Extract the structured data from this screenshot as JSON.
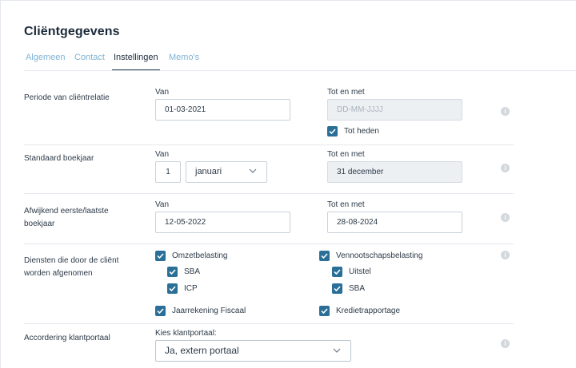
{
  "page": {
    "title": "Cliëntgegevens"
  },
  "tabs": [
    {
      "label": "Algemeen",
      "active": false
    },
    {
      "label": "Contact",
      "active": false
    },
    {
      "label": "Instellingen",
      "active": true
    },
    {
      "label": "Memo's",
      "active": false
    }
  ],
  "rows": {
    "periode": {
      "label": "Periode van cliëntrelatie",
      "van_label": "Van",
      "van_value": "01-03-2021",
      "tot_label": "Tot en met",
      "tot_placeholder": "DD-MM-JJJJ",
      "tot_heden_label": "Tot heden",
      "tot_heden_checked": true
    },
    "boekjaar": {
      "label": "Standaard boekjaar",
      "van_label": "Van",
      "dag_value": "1",
      "maand_value": "januari",
      "tot_label": "Tot en met",
      "tot_value": "31 december"
    },
    "afwijkend": {
      "label_line1": "Afwijkend eerste/laatste",
      "label_line2": "boekjaar",
      "van_label": "Van",
      "van_value": "12-05-2022",
      "tot_label": "Tot en met",
      "tot_value": "28-08-2024"
    },
    "diensten": {
      "label_line1": "Diensten die door de cliënt",
      "label_line2": "worden afgenomen",
      "left": [
        {
          "label": "Omzetbelasting",
          "checked": true
        },
        {
          "label": "SBA",
          "checked": true
        },
        {
          "label": "ICP",
          "checked": true
        },
        {
          "label": "Jaarrekening Fiscaal",
          "checked": true
        }
      ],
      "right": [
        {
          "label": "Vennootschapsbelasting",
          "checked": true
        },
        {
          "label": "Uitstel",
          "checked": true
        },
        {
          "label": "SBA",
          "checked": true
        },
        {
          "label": "Kredietrapportage",
          "checked": true
        }
      ]
    },
    "klantportaal": {
      "label": "Accordering klantportaal",
      "field_label": "Kies klantportaal:",
      "value": "Ja, extern portaal"
    }
  },
  "icons": {
    "info": "info-icon",
    "checkbox": "check-icon",
    "dropdown": "chevron-down-icon"
  },
  "colors": {
    "accent": "#2a6f97",
    "tab_inactive": "#7fb3d3",
    "text": "#2d3a48",
    "disabled_bg": "#edf0f3"
  }
}
